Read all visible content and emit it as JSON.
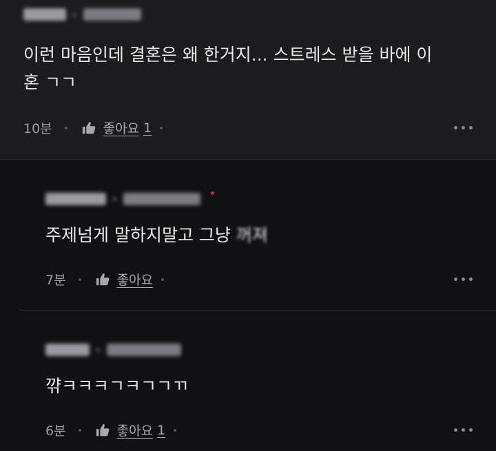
{
  "comments": [
    {
      "text": "이런 마음인데 결혼은 왜 한거지... 스트레스 받을 바에 이\n혼 ㄱㄱ",
      "time": "10분",
      "like_label": "좋아요",
      "like_count": "1"
    },
    {
      "text_before": "주제넘게 말하지말고 그냥 ",
      "text_blurred": "꺼져",
      "time": "7분",
      "like_label": "좋아요",
      "like_count": ""
    },
    {
      "text": "꺆ㅋㅋㅋㄱㅋㄱㄱㄲ",
      "time": "6분",
      "like_label": "좋아요",
      "like_count": "1"
    }
  ],
  "icons": {
    "like": "thumbs-up-icon",
    "more": "more-options-icon"
  },
  "colors": {
    "background": "#111114",
    "first_comment_background": "#1c1c1f",
    "text": "#e8e8ea",
    "meta": "#9b9ba0"
  }
}
